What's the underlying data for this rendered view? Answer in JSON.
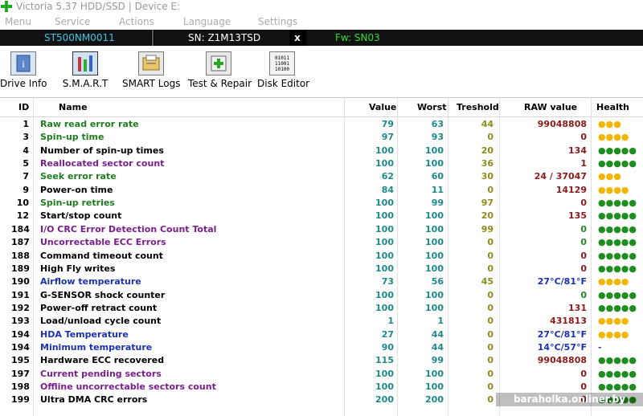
{
  "window": {
    "title": "Victoria 5.37 HDD/SSD | Device E:"
  },
  "menu": [
    "Menu",
    "Service",
    "Actions",
    "Language",
    "Settings"
  ],
  "device": {
    "model": "ST500NM0011",
    "serial": "SN: Z1M13TSD",
    "close": "x",
    "firmware": "Fw: SN03"
  },
  "toolbar": [
    {
      "label": "Drive Info",
      "icon": "info-icon"
    },
    {
      "label": "S.M.A.R.T",
      "icon": "smart-icon"
    },
    {
      "label": "SMART Logs",
      "icon": "logs-icon"
    },
    {
      "label": "Test & Repair",
      "icon": "test-repair-icon"
    },
    {
      "label": "Disk Editor",
      "icon": "disk-editor-icon"
    }
  ],
  "table": {
    "headers": {
      "id": "ID",
      "name": "Name",
      "value": "Value",
      "worst": "Worst",
      "treshold": "Treshold",
      "raw": "RAW value",
      "health": "Health"
    },
    "rows": [
      {
        "id": "1",
        "name": "Raw read error rate",
        "value": "79",
        "worst": "63",
        "treshold": "44",
        "raw": "99048808",
        "health": "●●●",
        "nc": "n-green",
        "hc": "hy",
        "rc": ""
      },
      {
        "id": "3",
        "name": "Spin-up time",
        "value": "97",
        "worst": "93",
        "treshold": "0",
        "raw": "0",
        "health": "●●●●",
        "nc": "n-green",
        "hc": "hy",
        "rc": ""
      },
      {
        "id": "4",
        "name": "Number of spin-up times",
        "value": "100",
        "worst": "100",
        "treshold": "20",
        "raw": "134",
        "health": "●●●●●",
        "nc": "n-black",
        "hc": "hg",
        "rc": ""
      },
      {
        "id": "5",
        "name": "Reallocated sector count",
        "value": "100",
        "worst": "100",
        "treshold": "36",
        "raw": "1",
        "health": "●●●●●",
        "nc": "n-purple",
        "hc": "hg",
        "rc": ""
      },
      {
        "id": "7",
        "name": "Seek error rate",
        "value": "62",
        "worst": "60",
        "treshold": "30",
        "raw": "24 / 37047",
        "health": "●●●",
        "nc": "n-green",
        "hc": "hy",
        "rc": ""
      },
      {
        "id": "9",
        "name": "Power-on time",
        "value": "84",
        "worst": "11",
        "treshold": "0",
        "raw": "14129",
        "health": "●●●●",
        "nc": "n-black",
        "hc": "hy",
        "rc": ""
      },
      {
        "id": "10",
        "name": "Spin-up retries",
        "value": "100",
        "worst": "99",
        "treshold": "97",
        "raw": "0",
        "health": "●●●●●",
        "nc": "n-green",
        "hc": "hg",
        "rc": ""
      },
      {
        "id": "12",
        "name": "Start/stop count",
        "value": "100",
        "worst": "100",
        "treshold": "20",
        "raw": "135",
        "health": "●●●●●",
        "nc": "n-black",
        "hc": "hg",
        "rc": ""
      },
      {
        "id": "184",
        "name": "I/O CRC Error Detection Count Total",
        "value": "100",
        "worst": "100",
        "treshold": "99",
        "raw": "0",
        "health": "●●●●●",
        "nc": "n-purple",
        "hc": "hg",
        "rc": "raw-green"
      },
      {
        "id": "187",
        "name": "Uncorrectable ECC Errors",
        "value": "100",
        "worst": "100",
        "treshold": "0",
        "raw": "0",
        "health": "●●●●●",
        "nc": "n-purple",
        "hc": "hg",
        "rc": "raw-green"
      },
      {
        "id": "188",
        "name": "Command timeout count",
        "value": "100",
        "worst": "100",
        "treshold": "0",
        "raw": "0",
        "health": "●●●●●",
        "nc": "n-black",
        "hc": "hg",
        "rc": ""
      },
      {
        "id": "189",
        "name": "High Fly writes",
        "value": "100",
        "worst": "100",
        "treshold": "0",
        "raw": "0",
        "health": "●●●●●",
        "nc": "n-black",
        "hc": "hg",
        "rc": ""
      },
      {
        "id": "190",
        "name": "Airflow temperature",
        "value": "73",
        "worst": "56",
        "treshold": "45",
        "raw": "27°C/81°F",
        "health": "●●●●",
        "nc": "n-blue",
        "hc": "hy",
        "rc": "raw-blue"
      },
      {
        "id": "191",
        "name": "G-SENSOR shock counter",
        "value": "100",
        "worst": "100",
        "treshold": "0",
        "raw": "0",
        "health": "●●●●●",
        "nc": "n-black",
        "hc": "hg",
        "rc": "raw-green"
      },
      {
        "id": "192",
        "name": "Power-off retract count",
        "value": "100",
        "worst": "100",
        "treshold": "0",
        "raw": "131",
        "health": "●●●●●",
        "nc": "n-black",
        "hc": "hg",
        "rc": ""
      },
      {
        "id": "193",
        "name": "Load/unload cycle count",
        "value": "1",
        "worst": "1",
        "treshold": "0",
        "raw": "431813",
        "health": "●●●●",
        "nc": "n-black",
        "hc": "hy",
        "rc": ""
      },
      {
        "id": "194",
        "name": "HDA Temperature",
        "value": "27",
        "worst": "44",
        "treshold": "0",
        "raw": "27°C/81°F",
        "health": "●●●●",
        "nc": "n-blue",
        "hc": "hy",
        "rc": "raw-blue"
      },
      {
        "id": "194",
        "name": "Minimum temperature",
        "value": "90",
        "worst": "44",
        "treshold": "0",
        "raw": "14°C/57°F",
        "health": "-",
        "nc": "n-blue",
        "hc": "hb",
        "rc": "raw-blue"
      },
      {
        "id": "195",
        "name": "Hardware ECC recovered",
        "value": "115",
        "worst": "99",
        "treshold": "0",
        "raw": "99048808",
        "health": "●●●●●",
        "nc": "n-black",
        "hc": "hg",
        "rc": ""
      },
      {
        "id": "197",
        "name": "Current pending sectors",
        "value": "100",
        "worst": "100",
        "treshold": "0",
        "raw": "0",
        "health": "●●●●●",
        "nc": "n-purple",
        "hc": "hg",
        "rc": ""
      },
      {
        "id": "198",
        "name": "Offline uncorrectable sectors count",
        "value": "100",
        "worst": "100",
        "treshold": "0",
        "raw": "0",
        "health": "●●●●●",
        "nc": "n-purple",
        "hc": "hg",
        "rc": ""
      },
      {
        "id": "199",
        "name": "Ultra DMA CRC errors",
        "value": "200",
        "worst": "200",
        "treshold": "0",
        "raw": "0",
        "health": "●●●●●",
        "nc": "n-black",
        "hc": "hg",
        "rc": ""
      }
    ]
  },
  "watermark": "baraholka.onliner.by"
}
